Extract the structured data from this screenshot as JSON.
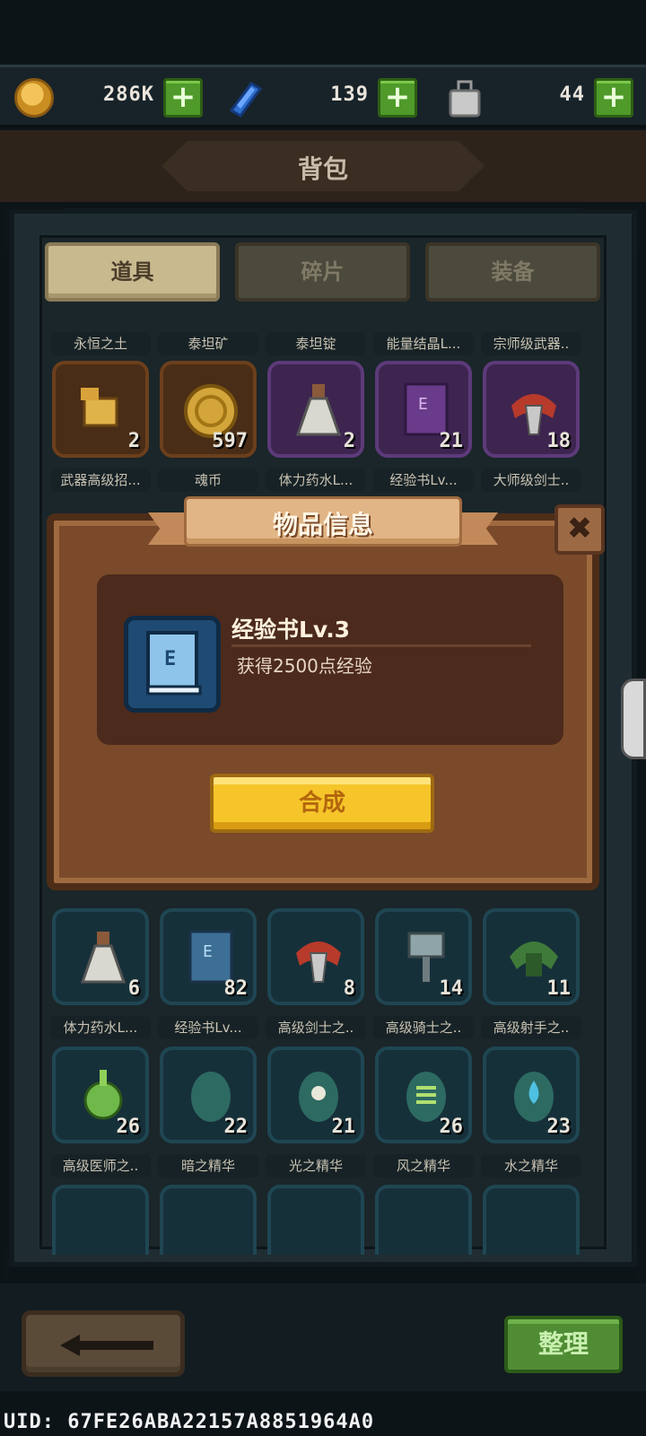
{
  "currency": {
    "gold": "286K",
    "gems": "139",
    "weight": "44",
    "plus_label": "+"
  },
  "header": {
    "title": "背包"
  },
  "tabs": [
    {
      "label": "道具",
      "active": true
    },
    {
      "label": "碎片",
      "active": false
    },
    {
      "label": "装备",
      "active": false
    }
  ],
  "grid": {
    "row0_labels": [
      "永恒之土",
      "泰坦矿",
      "泰坦锭",
      "能量结晶L...",
      "宗师级武器.."
    ],
    "row1": [
      {
        "label": "武器高级招...",
        "count": "2",
        "icon": "weapon-scroll-icon",
        "rarity": "orange"
      },
      {
        "label": "魂币",
        "count": "597",
        "icon": "soul-coin-icon",
        "rarity": "orange"
      },
      {
        "label": "体力药水L...",
        "count": "2",
        "icon": "potion-icon",
        "rarity": "purple"
      },
      {
        "label": "经验书Lv...",
        "count": "21",
        "icon": "exp-book-icon",
        "rarity": "purple"
      },
      {
        "label": "大师级剑士..",
        "count": "18",
        "icon": "sword-emblem-icon",
        "rarity": "purple"
      }
    ],
    "row2": [
      {
        "label": "体力药水L...",
        "count": "6",
        "icon": "potion-icon",
        "rarity": "teal"
      },
      {
        "label": "经验书Lv...",
        "count": "82",
        "icon": "exp-book-icon",
        "rarity": "teal"
      },
      {
        "label": "高级剑士之..",
        "count": "8",
        "icon": "sword-emblem-icon",
        "rarity": "teal"
      },
      {
        "label": "高级骑士之..",
        "count": "14",
        "icon": "knight-emblem-icon",
        "rarity": "teal"
      },
      {
        "label": "高级射手之..",
        "count": "11",
        "icon": "archer-emblem-icon",
        "rarity": "teal"
      }
    ],
    "row3": [
      {
        "label": "高级医师之..",
        "count": "26",
        "icon": "healer-emblem-icon",
        "rarity": "teal"
      },
      {
        "label": "暗之精华",
        "count": "22",
        "icon": "dark-essence-icon",
        "rarity": "teal"
      },
      {
        "label": "光之精华",
        "count": "21",
        "icon": "light-essence-icon",
        "rarity": "teal"
      },
      {
        "label": "风之精华",
        "count": "26",
        "icon": "wind-essence-icon",
        "rarity": "teal"
      },
      {
        "label": "水之精华",
        "count": "23",
        "icon": "water-essence-icon",
        "rarity": "teal"
      }
    ]
  },
  "modal": {
    "title": "物品信息",
    "close_label": "✖",
    "item_name": "经验书Lv.3",
    "item_desc": "获得2500点经验",
    "craft_label": "合成"
  },
  "bottom": {
    "sort_label": "整理",
    "uid": "UID: 67FE26ABA22157A8851964A0"
  },
  "colors": {
    "accent_green": "#4f9a2a",
    "craft_yellow": "#f6c52a",
    "modal_brown": "#7a4a2a"
  }
}
